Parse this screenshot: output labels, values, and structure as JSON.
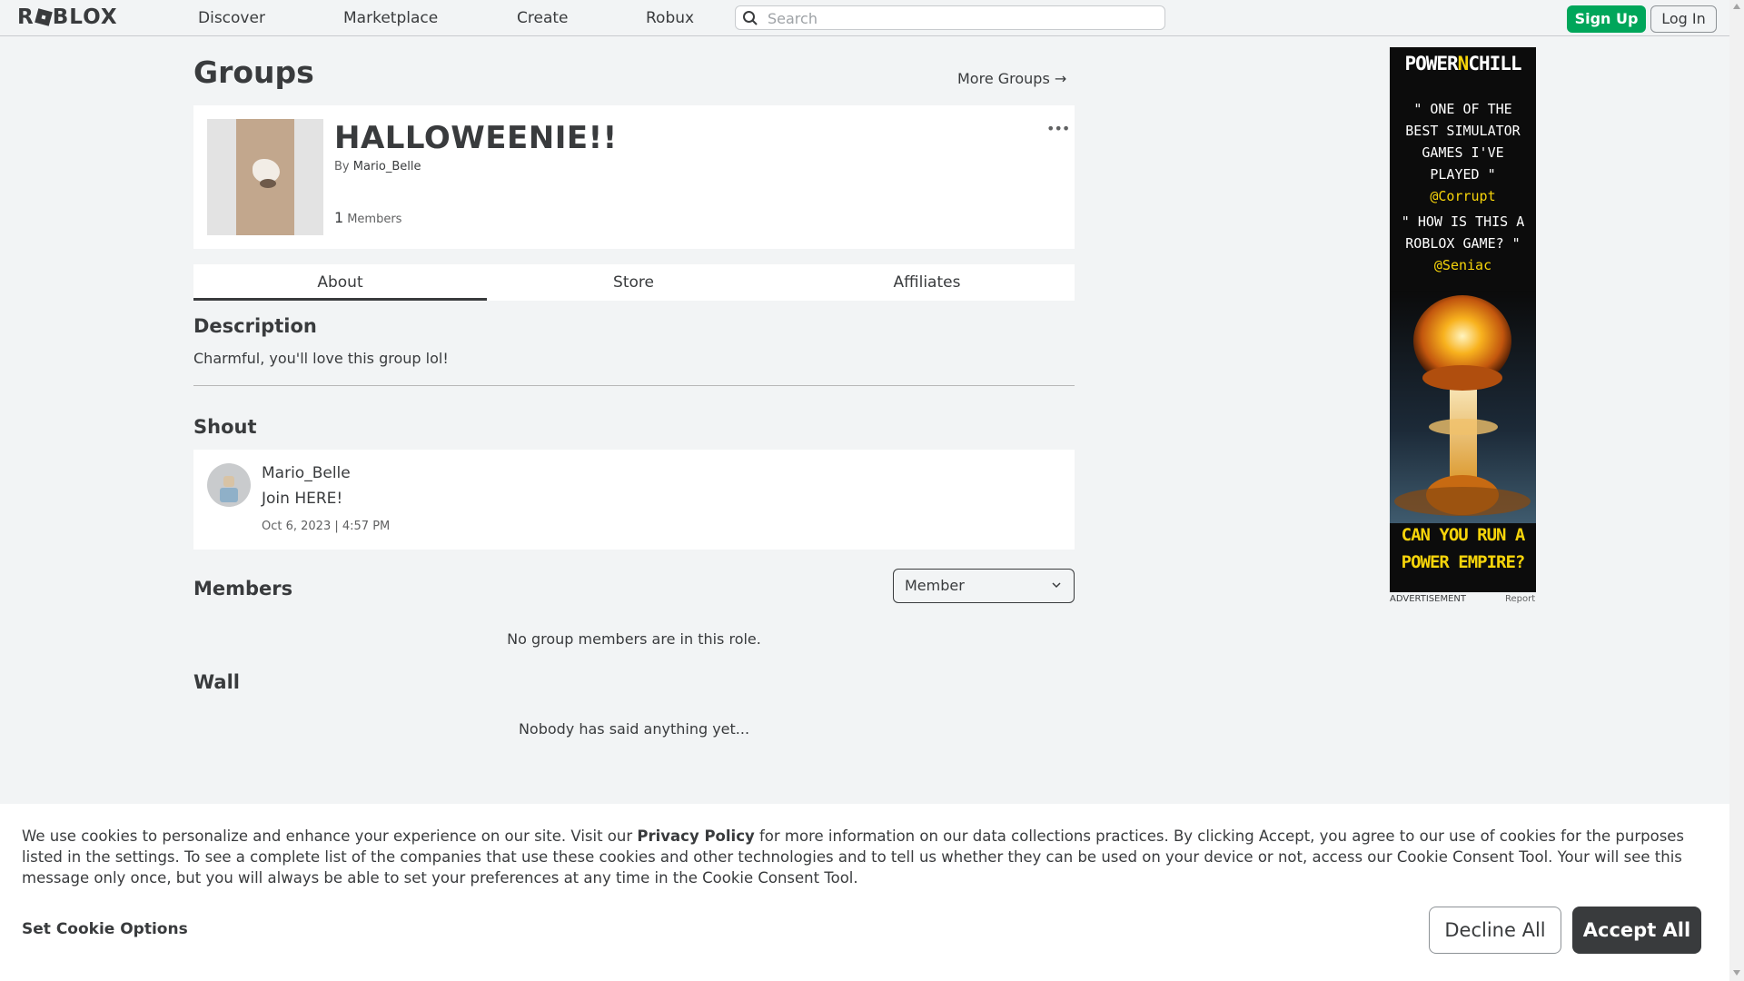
{
  "header": {
    "logo": "ROBLOX",
    "nav": [
      "Discover",
      "Marketplace",
      "Create",
      "Robux"
    ],
    "search_placeholder": "Search",
    "signup_label": "Sign Up",
    "login_label": "Log In"
  },
  "page": {
    "title": "Groups",
    "more_groups": "More Groups →"
  },
  "group": {
    "name": "HALLOWEENIE!!",
    "by_label": "By",
    "owner": "Mario_Belle",
    "member_count": "1",
    "members_label": "Members",
    "more_menu": "•••"
  },
  "tabs": [
    "About",
    "Store",
    "Affiliates"
  ],
  "description": {
    "heading": "Description",
    "text": "Charmful, you'll love this group lol!"
  },
  "shout": {
    "heading": "Shout",
    "user": "Mario_Belle",
    "message": "Join HERE!",
    "time": "Oct 6, 2023 | 4:57 PM"
  },
  "members": {
    "heading": "Members",
    "role_selected": "Member",
    "empty": "No group members are in this role."
  },
  "wall": {
    "heading": "Wall",
    "empty": "Nobody has said anything yet..."
  },
  "ad": {
    "brand_pre": "POWER",
    "brand_n": "N",
    "brand_post": "CHILL",
    "quote1": "\" ONE OF THE BEST SIMULATOR GAMES I'VE PLAYED \"",
    "handle1": "@Corrupt",
    "quote2": "\" HOW IS THIS A ROBLOX GAME? \"",
    "handle2": "@Seniac",
    "cta": "CAN YOU RUN A POWER EMPIRE?",
    "label": "ADVERTISEMENT",
    "report": "Report"
  },
  "cookie": {
    "text_before": "We use cookies to personalize and enhance your experience on our site. Visit our ",
    "privacy_link": "Privacy Policy",
    "text_after": " for more information on our data collections practices. By clicking Accept, you agree to our use of cookies for the purposes listed in the settings. To see a complete list of the companies that use these cookies and other technologies and to tell us whether they can be used on your device or not, access our Cookie Consent Tool. Your will see this message only once, but you will always be able to set your preferences at any time in the Cookie Consent Tool.",
    "set_options": "Set Cookie Options",
    "decline": "Decline All",
    "accept": "Accept All"
  },
  "colors": {
    "signup_green": "#00a65a",
    "ad_yellow": "#f6d40a",
    "accept_dark": "#393b3d"
  }
}
